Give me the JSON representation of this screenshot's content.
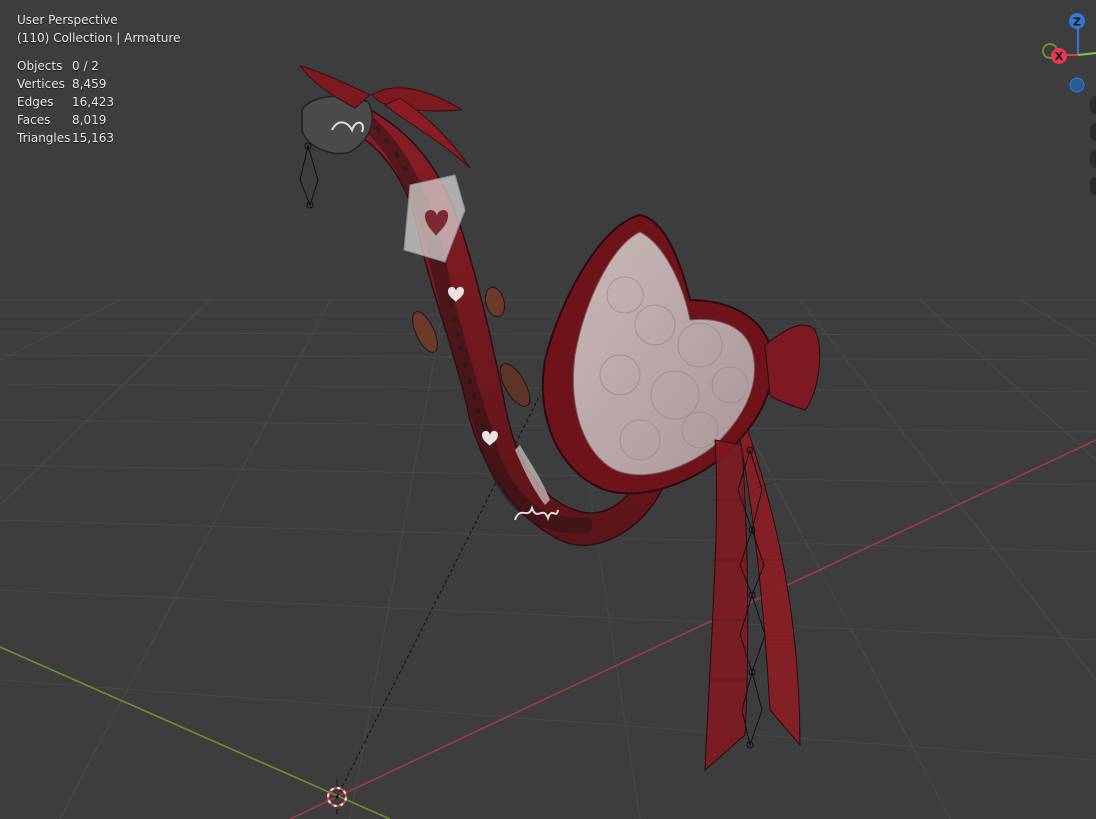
{
  "viewport": {
    "view_name": "User Perspective",
    "collection_line": "(110) Collection | Armature"
  },
  "stats": [
    {
      "label": "Objects",
      "value": "0 / 2"
    },
    {
      "label": "Vertices",
      "value": "8,459"
    },
    {
      "label": "Edges",
      "value": "16,423"
    },
    {
      "label": "Faces",
      "value": "8,019"
    },
    {
      "label": "Triangles",
      "value": "15,163"
    }
  ],
  "gizmo": {
    "z_label": "Z",
    "x_label": "X",
    "colors": {
      "x": "#e8384f",
      "y": "#8bc34a",
      "z": "#2f7ad8"
    }
  },
  "colors": {
    "background": "#3d3d3d",
    "grid": "#4b4b4b",
    "x_axis": "#9e3a48",
    "y_axis": "#6d8f2f",
    "model_red": "#8f1d23",
    "model_dark": "#3a1b1d",
    "box_inner": "#cfc9c9"
  }
}
